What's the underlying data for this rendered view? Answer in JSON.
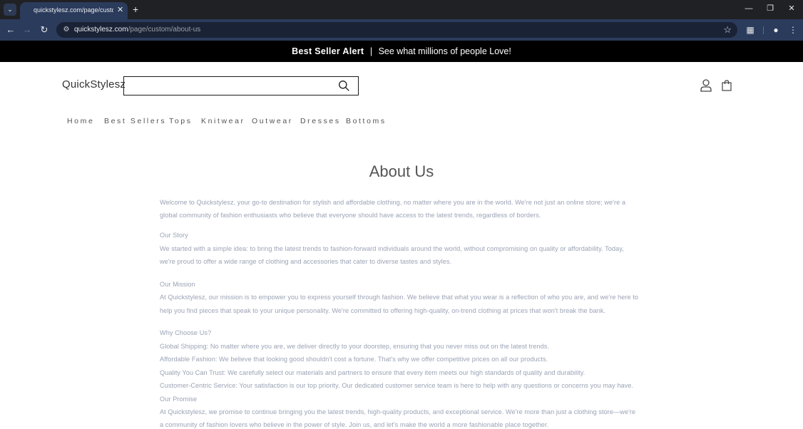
{
  "browser": {
    "tab_title": "quickstylesz.com/page/custom/",
    "url_host": "quickstylesz.com",
    "url_path": "/page/custom/about-us"
  },
  "announcement": {
    "bold": "Best Seller Alert",
    "separator": "|",
    "text": "See what millions of people Love!"
  },
  "header": {
    "logo": "QuickStylesz",
    "search_placeholder": ""
  },
  "nav": [
    "Home",
    "Best Sellers",
    "Tops",
    "Knitwear",
    "Outwear",
    "Dresses",
    "Bottoms"
  ],
  "content": {
    "title": "About Us",
    "lines": [
      "Welcome to Quickstylesz, your go-to destination for stylish and affordable clothing, no matter where you are in the world. We're not just an online store; we're a",
      "global community of fashion enthusiasts who believe that everyone should have access to the latest trends, regardless of borders.",
      "Our Story",
      "We started with a simple idea: to bring the latest trends to fashion-forward individuals around the world, without compromising on quality or affordability. Today,",
      "we're proud to offer a wide range of clothing and accessories that cater to diverse tastes and styles.",
      "Our Mission",
      "At Quickstylesz, our mission is to empower you to express yourself through fashion. We believe that what you wear is a reflection of who you are, and we're here to",
      "help you find pieces that speak to your unique personality. We're committed to offering high-quality, on-trend clothing at prices that won't break the bank.",
      "Why Choose Us?",
      "Global Shipping: No matter where you are, we deliver directly to your doorstep, ensuring that you never miss out on the latest trends.",
      "Affordable Fashion: We believe that looking good shouldn't cost a fortune. That's why we offer competitive prices on all our products.",
      "Quality You Can Trust: We carefully select our materials and partners to ensure that every item meets our high standards of quality and durability.",
      "Customer-Centric Service: Your satisfaction is our top priority. Our dedicated customer service team is here to help with any questions or concerns you may have.",
      "Our Promise",
      "At Quickstylesz, we promise to continue bringing you the latest trends, high-quality products, and exceptional service. We're more than just a clothing store—we're",
      "a community of fashion lovers who believe in the power of style. Join us, and let's make the world a more fashionable place together."
    ]
  }
}
